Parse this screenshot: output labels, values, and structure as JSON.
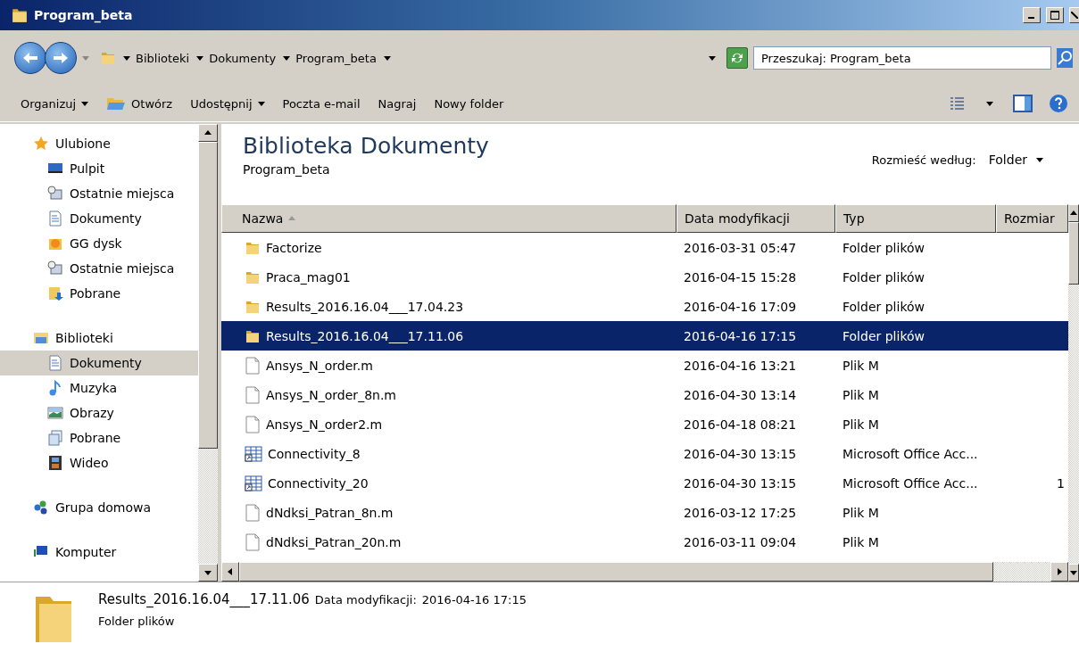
{
  "window": {
    "title": "Program_beta"
  },
  "address": {
    "crumbs": [
      "Biblioteki",
      "Dokumenty",
      "Program_beta"
    ]
  },
  "search": {
    "placeholder": "Przeszukaj: Program_beta"
  },
  "toolbar": [
    {
      "label": "Organizuj",
      "kind": "menu"
    },
    {
      "label": "Otwórz",
      "kind": "open"
    },
    {
      "label": "Udostępnij",
      "kind": "menu"
    },
    {
      "label": "Poczta e-mail",
      "kind": "plain"
    },
    {
      "label": "Nagraj",
      "kind": "plain"
    },
    {
      "label": "Nowy folder",
      "kind": "plain"
    }
  ],
  "sidebar": {
    "groups": [
      {
        "label": "Ulubione",
        "kind": "star",
        "children": [
          {
            "label": "Pulpit",
            "kind": "desktop",
            "selected": false
          },
          {
            "label": "Ostatnie miejsca",
            "kind": "recent",
            "selected": false
          },
          {
            "label": "Dokumenty",
            "kind": "doc",
            "selected": false
          },
          {
            "label": "GG dysk",
            "kind": "sun",
            "selected": false
          },
          {
            "label": "Ostatnie miejsca",
            "kind": "recent",
            "selected": false
          },
          {
            "label": "Pobrane",
            "kind": "download",
            "selected": false
          }
        ]
      },
      {
        "label": "Biblioteki",
        "kind": "library",
        "children": [
          {
            "label": "Dokumenty",
            "kind": "doc",
            "selected": true
          },
          {
            "label": "Muzyka",
            "kind": "music",
            "selected": false
          },
          {
            "label": "Obrazy",
            "kind": "image",
            "selected": false
          },
          {
            "label": "Pobrane",
            "kind": "pages",
            "selected": false
          },
          {
            "label": "Wideo",
            "kind": "film",
            "selected": false
          }
        ]
      },
      {
        "label": "Grupa domowa",
        "kind": "homegroup"
      },
      {
        "label": "Komputer",
        "kind": "computer"
      }
    ]
  },
  "library": {
    "title": "Biblioteka Dokumenty",
    "subtitle": "Program_beta",
    "arrange_label": "Rozmieść według:",
    "arrange_value": "Folder"
  },
  "table": {
    "columns": [
      {
        "label": "Nazwa",
        "sorted": true
      },
      {
        "label": "Data modyfikacji",
        "sorted": false
      },
      {
        "label": "Typ",
        "sorted": false
      },
      {
        "label": "Rozmiar",
        "sorted": false
      }
    ],
    "rows": [
      {
        "name": "Factorize",
        "date": "2016-03-31 05:47",
        "type": "Folder plików",
        "kind": "folder",
        "selected": false
      },
      {
        "name": "Praca_mag01",
        "date": "2016-04-15 15:28",
        "type": "Folder plików",
        "kind": "folder",
        "selected": false
      },
      {
        "name": "Results_2016.16.04___17.04.23",
        "date": "2016-04-16 17:09",
        "type": "Folder plików",
        "kind": "folder",
        "selected": false
      },
      {
        "name": "Results_2016.16.04___17.11.06",
        "date": "2016-04-16 17:15",
        "type": "Folder plików",
        "kind": "folder",
        "selected": true
      },
      {
        "name": "Ansys_N_order.m",
        "date": "2016-04-16 13:21",
        "type": "Plik M",
        "kind": "file",
        "selected": false
      },
      {
        "name": "Ansys_N_order_8n.m",
        "date": "2016-04-30 13:14",
        "type": "Plik M",
        "kind": "file",
        "selected": false
      },
      {
        "name": "Ansys_N_order2.m",
        "date": "2016-04-18 08:21",
        "type": "Plik M",
        "kind": "file",
        "selected": false
      },
      {
        "name": "Connectivity_8",
        "date": "2016-04-30 13:15",
        "type": "Microsoft Office Acc...",
        "kind": "table",
        "selected": false
      },
      {
        "name": "Connectivity_20",
        "date": "2016-04-30 13:15",
        "type": "Microsoft Office Acc...",
        "size": "1",
        "kind": "table",
        "selected": false
      },
      {
        "name": "dNdksi_Patran_8n.m",
        "date": "2016-03-12 17:25",
        "type": "Plik M",
        "kind": "file",
        "selected": false
      },
      {
        "name": "dNdksi_Patran_20n.m",
        "date": "2016-03-11 09:04",
        "type": "Plik M",
        "kind": "file",
        "selected": false
      }
    ]
  },
  "details": {
    "name": "Results_2016.16.04___17.11.06",
    "date_label": "Data modyfikacji:",
    "date": "2016-04-16 17:15",
    "type": "Folder plików"
  }
}
